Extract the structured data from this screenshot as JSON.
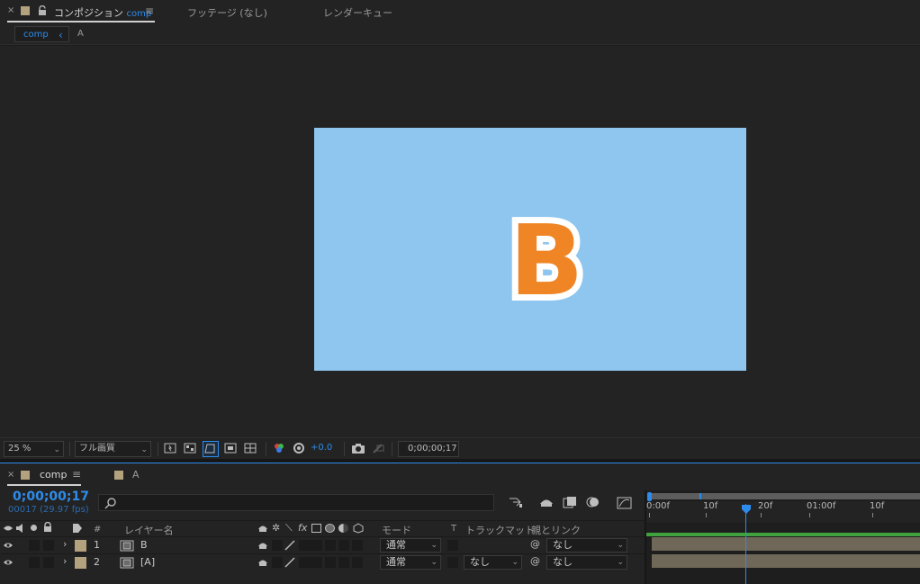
{
  "top_tabs": {
    "close_glyph": "×",
    "comp_tab_label": "コンポジション",
    "comp_tab_name": "comp",
    "menu_glyph": "≡",
    "footage_tab": "フッテージ (なし)",
    "render_tab": "レンダーキュー"
  },
  "subbar": {
    "crumb_active": "comp",
    "crumb_arrow": "‹",
    "crumb_next": "A"
  },
  "canvas": {
    "letter": "B",
    "background_color": "#8ec6ef",
    "letter_color": "#f08525",
    "stroke_color": "#ffffff"
  },
  "viewer_toolbar": {
    "zoom": "25 %",
    "quality": "フル画質",
    "exposure": "+0.0",
    "timecode": "0;00;00;17"
  },
  "timeline": {
    "tab_close": "×",
    "tab_name": "comp",
    "tab_menu": "≡",
    "tab2_name": "A",
    "current_time": "0;00;00;17",
    "frame_info": "00017 (29.97 fps)",
    "search_placeholder": "",
    "headers": {
      "hash": "#",
      "layer_name": "レイヤー名",
      "mode": "モード",
      "t": "T",
      "track_matte": "トラックマット",
      "parent": "親とリンク"
    },
    "layers": [
      {
        "num": "1",
        "name": "B",
        "mode": "通常",
        "track_matte": "",
        "parent": "なし"
      },
      {
        "num": "2",
        "name": "[A]",
        "mode": "通常",
        "track_matte": "なし",
        "parent": "なし"
      }
    ],
    "ruler_labels": [
      "0:00f",
      "10f",
      "20f",
      "01:00f",
      "10f"
    ],
    "playhead_fraction": 0.57,
    "playhead_color": "#2d8ceb",
    "label_color": "#b4a27f",
    "bar_color": "#6f6757",
    "workarea_color": "#5d5d5d"
  }
}
